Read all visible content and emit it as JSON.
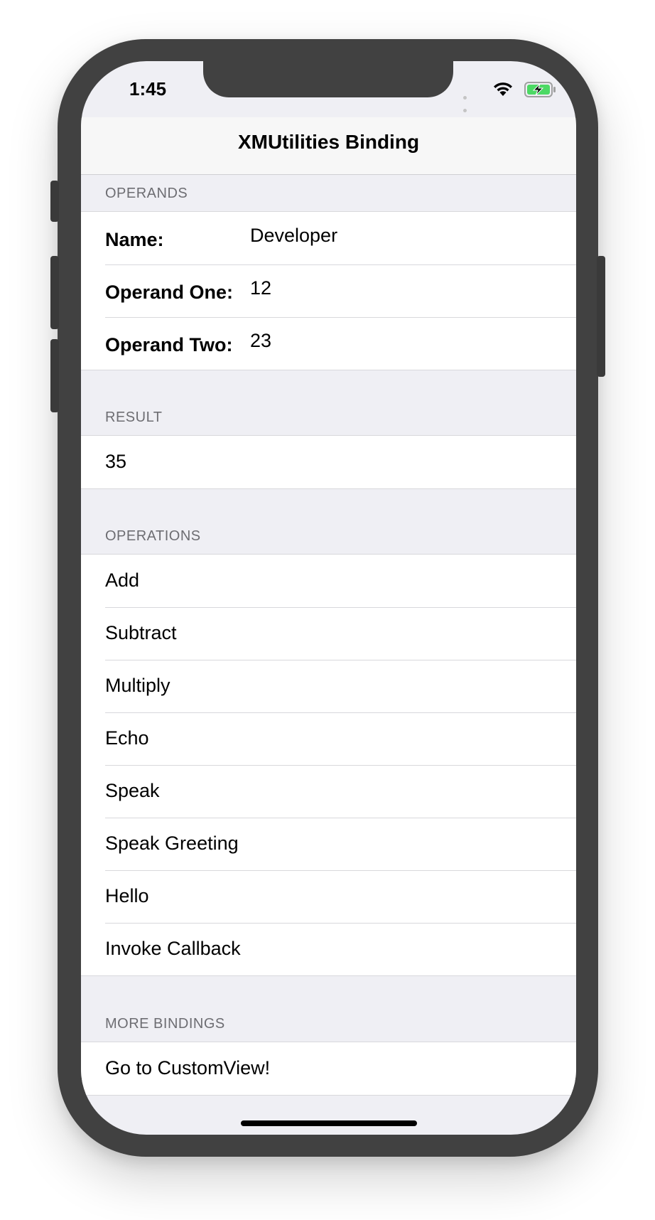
{
  "status_bar": {
    "time": "1:45"
  },
  "nav": {
    "title": "XMUtilities Binding"
  },
  "sections": {
    "operands": {
      "header": "OPERANDS",
      "rows": [
        {
          "label": "Name:",
          "value": "Developer"
        },
        {
          "label": "Operand One:",
          "value": "12"
        },
        {
          "label": "Operand Two:",
          "value": "23"
        }
      ]
    },
    "result": {
      "header": "RESULT",
      "value": "35"
    },
    "operations": {
      "header": "OPERATIONS",
      "items": [
        "Add",
        "Subtract",
        "Multiply",
        "Echo",
        "Speak",
        "Speak Greeting",
        "Hello",
        "Invoke Callback"
      ]
    },
    "more": {
      "header": "MORE BINDINGS",
      "items": [
        "Go to CustomView!"
      ]
    }
  },
  "colors": {
    "phone_frame": "#414141",
    "background": "#efeff4",
    "section_header_text": "#6d6d72",
    "battery_fill": "#4cd964"
  }
}
